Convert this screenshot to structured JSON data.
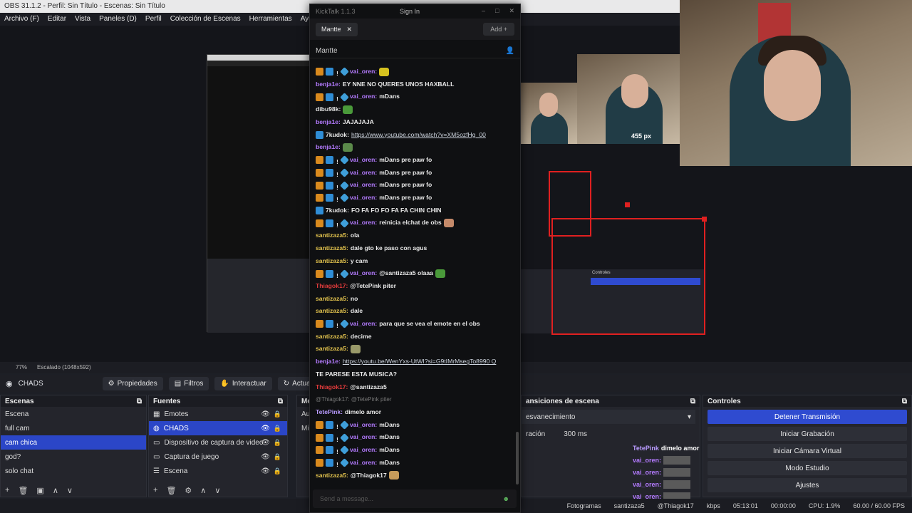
{
  "window": {
    "title": "OBS 31.1.2 - Perfil: Sin Título - Escenas: Sin Título"
  },
  "menu": [
    "Archivo (F)",
    "Editar",
    "Vista",
    "Paneles (D)",
    "Perfil",
    "Colección de Escenas",
    "Herramientas",
    "Ayuda (H)"
  ],
  "preview": {
    "size_label": "455 px"
  },
  "status": {
    "zoom": "77%",
    "scale": "Escalado (1048x592)"
  },
  "toolbar": {
    "source": "CHADS",
    "properties": "Propiedades",
    "filters": "Filtros",
    "interact": "Interactuar",
    "refresh": "Actualizar"
  },
  "scenes": {
    "title": "Escenas",
    "items": [
      "Escena",
      "full cam",
      "cam chica",
      "god?",
      "solo chat"
    ],
    "selected": 2
  },
  "sources": {
    "title": "Fuentes",
    "items": [
      "Emotes",
      "CHADS",
      "Dispositivo de captura de video",
      "Captura de juego",
      "Escena"
    ],
    "selected": 1
  },
  "mixer": {
    "title": "Me",
    "rows": [
      "Au",
      "Mic"
    ]
  },
  "transitions": {
    "title": "ansiciones de escena",
    "type": "esvanecimiento",
    "duration_label": "ración",
    "duration": "300 ms"
  },
  "controls": {
    "title": "Controles",
    "stop_stream": "Detener Transmisión",
    "start_record": "Iniciar Grabación",
    "virtual_cam": "Iniciar Cámara Virtual",
    "studio": "Modo Estudio",
    "settings": "Ajustes"
  },
  "bottom": {
    "left": "Fotogramas",
    "chat_overlay": "santizaza5",
    "reply_overlay": "@Thiagok17",
    "bitrate": "kbps",
    "stream_time": "05:13:01",
    "rec_time": "00:00:00",
    "cpu": "CPU: 1.9%",
    "fps": "60.00 / 60.00 FPS"
  },
  "overlay": {
    "lines": [
      {
        "user": "TetePink",
        "text": "dimelo amor",
        "color": "#b99bff"
      },
      {
        "user": "vai_oren:",
        "text": "",
        "color": "#b47bff"
      },
      {
        "user": "vai_oren:",
        "text": "",
        "color": "#b47bff"
      },
      {
        "user": "vai_oren:",
        "text": "",
        "color": "#b47bff"
      },
      {
        "user": "vai_oren:",
        "text": "",
        "color": "#b47bff"
      }
    ]
  },
  "kicktalk": {
    "title": "KickTalk 1.1.3",
    "signin": "Sign In",
    "tab": "Mantte",
    "add": "Add",
    "channel": "Mantte",
    "input_placeholder": "Send a message...",
    "messages": [
      {
        "badges": [
          "7",
          "x",
          "i",
          "d"
        ],
        "user": "vai_oren:",
        "color": "#b47bff",
        "text": "",
        "emote": "#d6c21f"
      },
      {
        "badges": [],
        "user": "benja1e:",
        "color": "#b47bff",
        "text": "EY NNE NO QUERES UNOS HAXBALL"
      },
      {
        "badges": [
          "7",
          "x",
          "i",
          "d"
        ],
        "user": "vai_oren:",
        "color": "#b47bff",
        "text": "mDans"
      },
      {
        "badges": [],
        "user": "dibu98k:",
        "color": "#e6e6e6",
        "text": "",
        "emote": "#4a9a3a"
      },
      {
        "badges": [],
        "user": "benja1e:",
        "color": "#b47bff",
        "text": "JAJAJAJA"
      },
      {
        "badges": [
          "x"
        ],
        "user": "7kudok:",
        "color": "#e6e6e6",
        "text": "https://www.youtube.com/watch?v=XM5ozfHg_00",
        "link": true
      },
      {
        "badges": [],
        "user": "benja1e:",
        "color": "#b47bff",
        "text": "",
        "emote": "#5b8a4a"
      },
      {
        "badges": [
          "7",
          "x",
          "i",
          "d"
        ],
        "user": "vai_oren:",
        "color": "#b47bff",
        "text": "mDans pre paw fo"
      },
      {
        "badges": [
          "7",
          "x",
          "i",
          "d"
        ],
        "user": "vai_oren:",
        "color": "#b47bff",
        "text": "mDans pre paw fo"
      },
      {
        "badges": [
          "7",
          "x",
          "i",
          "d"
        ],
        "user": "vai_oren:",
        "color": "#b47bff",
        "text": "mDans pre paw fo"
      },
      {
        "badges": [
          "7",
          "x",
          "i",
          "d"
        ],
        "user": "vai_oren:",
        "color": "#b47bff",
        "text": "mDans pre paw fo"
      },
      {
        "badges": [
          "x"
        ],
        "user": "7kudok:",
        "color": "#e6e6e6",
        "text": "FO FA FO FO FA FA CHIN CHIN"
      },
      {
        "badges": [
          "7",
          "x",
          "i",
          "d"
        ],
        "user": "vai_oren:",
        "color": "#b47bff",
        "text": "reinicia elchat de obs",
        "emote": "#c58a6a"
      },
      {
        "badges": [],
        "user": "santizaza5:",
        "color": "#e0c14d",
        "text": "ola"
      },
      {
        "badges": [],
        "user": "santizaza5:",
        "color": "#e0c14d",
        "text": "dale gto ke paso con agus"
      },
      {
        "badges": [],
        "user": "santizaza5:",
        "color": "#e0c14d",
        "text": "y cam"
      },
      {
        "badges": [
          "7",
          "x",
          "i",
          "d"
        ],
        "user": "vai_oren:",
        "color": "#b47bff",
        "text": "@santizaza5 olaaa",
        "emote": "#4a9a3a"
      },
      {
        "badges": [],
        "user": "Thiagok17:",
        "color": "#e23b3b",
        "text": "@TetePink piter"
      },
      {
        "badges": [],
        "user": "santizaza5:",
        "color": "#e0c14d",
        "text": "no"
      },
      {
        "badges": [],
        "user": "santizaza5:",
        "color": "#e0c14d",
        "text": "dale"
      },
      {
        "badges": [
          "7",
          "x",
          "i",
          "d"
        ],
        "user": "vai_oren:",
        "color": "#b47bff",
        "text": "para que se vea el emote en el obs"
      },
      {
        "badges": [],
        "user": "santizaza5:",
        "color": "#e0c14d",
        "text": "decime"
      },
      {
        "badges": [],
        "user": "santizaza5:",
        "color": "#e0c14d",
        "text": "",
        "emote": "#9a9a6a"
      },
      {
        "badges": [],
        "user": "benja1e:",
        "color": "#b47bff",
        "text": "https://youtu.be/WenYxs-UtWI?si=G9tIMrMsegTo8990 Q",
        "link": true
      },
      {
        "badges": [],
        "user": "",
        "color": "#e6e6e6",
        "text": "TE PARESE ESTA MUSICA?"
      },
      {
        "badges": [],
        "user": "Thiagok17:",
        "color": "#e23b3b",
        "text": "@santizaza5"
      },
      {
        "badges": [],
        "user": "",
        "color": "#777777",
        "text": "@Thiagok17: @TetePink piter",
        "reply": true
      },
      {
        "badges": [],
        "user": "TetePink:",
        "color": "#b99bff",
        "text": "dimelo amor"
      },
      {
        "badges": [
          "7",
          "x",
          "i",
          "d"
        ],
        "user": "vai_oren:",
        "color": "#b47bff",
        "text": "mDans"
      },
      {
        "badges": [
          "7",
          "x",
          "i",
          "d"
        ],
        "user": "vai_oren:",
        "color": "#b47bff",
        "text": "mDans"
      },
      {
        "badges": [
          "7",
          "x",
          "i",
          "d"
        ],
        "user": "vai_oren:",
        "color": "#b47bff",
        "text": "mDans"
      },
      {
        "badges": [
          "7",
          "x",
          "i",
          "d"
        ],
        "user": "vai_oren:",
        "color": "#b47bff",
        "text": "mDans"
      },
      {
        "badges": [],
        "user": "santizaza5:",
        "color": "#e0c14d",
        "text": "@Thiagok17",
        "emote": "#c59a5a"
      }
    ]
  }
}
